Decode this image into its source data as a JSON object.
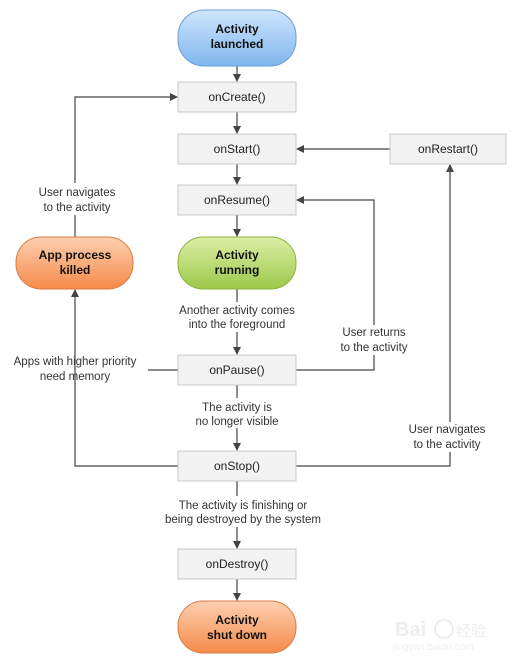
{
  "states": {
    "launched": [
      "Activity",
      "launched"
    ],
    "running": [
      "Activity",
      "running"
    ],
    "killed": [
      "App process",
      "killed"
    ],
    "shutdown": [
      "Activity",
      "shut down"
    ]
  },
  "callbacks": {
    "onCreate": "onCreate()",
    "onStart": "onStart()",
    "onRestart": "onRestart()",
    "onResume": "onResume()",
    "onPause": "onPause()",
    "onStop": "onStop()",
    "onDestroy": "onDestroy()"
  },
  "transitions": {
    "user_navigates_left": [
      "User navigates",
      "to the activity"
    ],
    "another_activity": [
      "Another activity comes",
      "into the foreground"
    ],
    "user_returns": [
      "User returns",
      "to the activity"
    ],
    "higher_priority": [
      "Apps with higher priority",
      "need memory"
    ],
    "no_longer_visible": [
      "The activity is",
      "no longer visible"
    ],
    "user_navigates_right": [
      "User navigates",
      "to the activity"
    ],
    "finishing": [
      "The activity is finishing or",
      "being destroyed by the system"
    ]
  },
  "colors": {
    "launched": "#9cc9f5",
    "running": "#b5d86a",
    "killed_shutdown": "#f9a36c"
  },
  "watermark": "Bai du 经验 jingyan.baidu.com"
}
